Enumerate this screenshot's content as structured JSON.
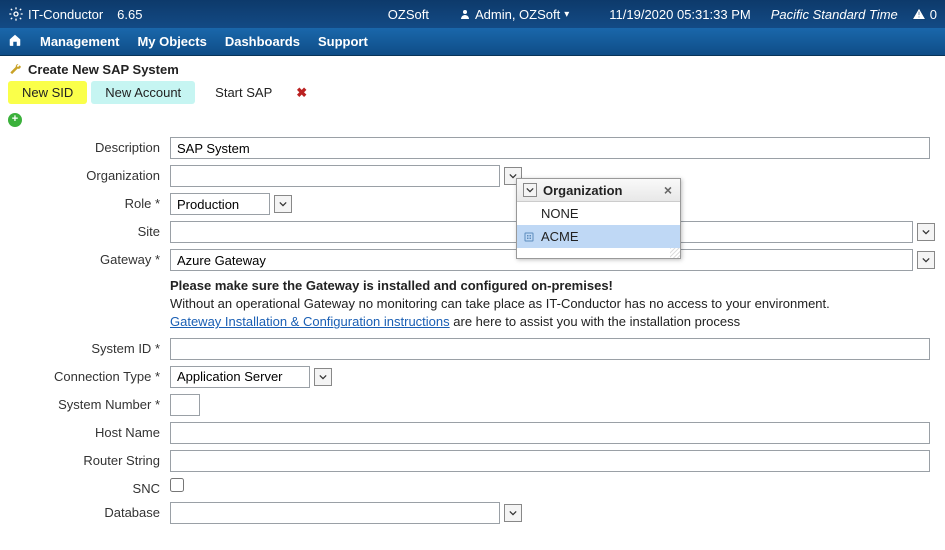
{
  "topbar": {
    "app_name": "IT-Conductor",
    "version": "6.65",
    "tenant": "OZSoft",
    "user": "Admin, OZSoft",
    "datetime": "11/19/2020 05:31:33 PM",
    "timezone": "Pacific Standard Time",
    "alert_count": "0"
  },
  "menu": {
    "management": "Management",
    "my_objects": "My Objects",
    "dashboards": "Dashboards",
    "support": "Support"
  },
  "page": {
    "title": "Create New SAP System"
  },
  "wizard": {
    "step1": "New SID",
    "step2": "New Account",
    "step3": "Start SAP"
  },
  "labels": {
    "description": "Description",
    "organization": "Organization",
    "role": "Role",
    "site": "Site",
    "gateway": "Gateway",
    "system_id": "System ID",
    "connection_type": "Connection Type",
    "system_number": "System Number",
    "host_name": "Host Name",
    "router_string": "Router String",
    "snc": "SNC",
    "database": "Database"
  },
  "values": {
    "description": "SAP System",
    "organization": "",
    "role": "Production",
    "site": "",
    "gateway": "Azure Gateway",
    "system_id": "",
    "connection_type": "Application Server",
    "system_number": "",
    "host_name": "",
    "router_string": "",
    "database": ""
  },
  "gateway_note": {
    "bold": "Please make sure the Gateway is installed and configured on-premises!",
    "line2": "Without an operational Gateway no monitoring can take place as IT-Conductor has no access to your environment.",
    "link": "Gateway Installation & Configuration instructions",
    "line3_tail": " are here to assist you with the installation process"
  },
  "popup": {
    "title": "Organization",
    "options": [
      {
        "label": "NONE",
        "selected": false
      },
      {
        "label": "ACME",
        "selected": true
      }
    ]
  }
}
